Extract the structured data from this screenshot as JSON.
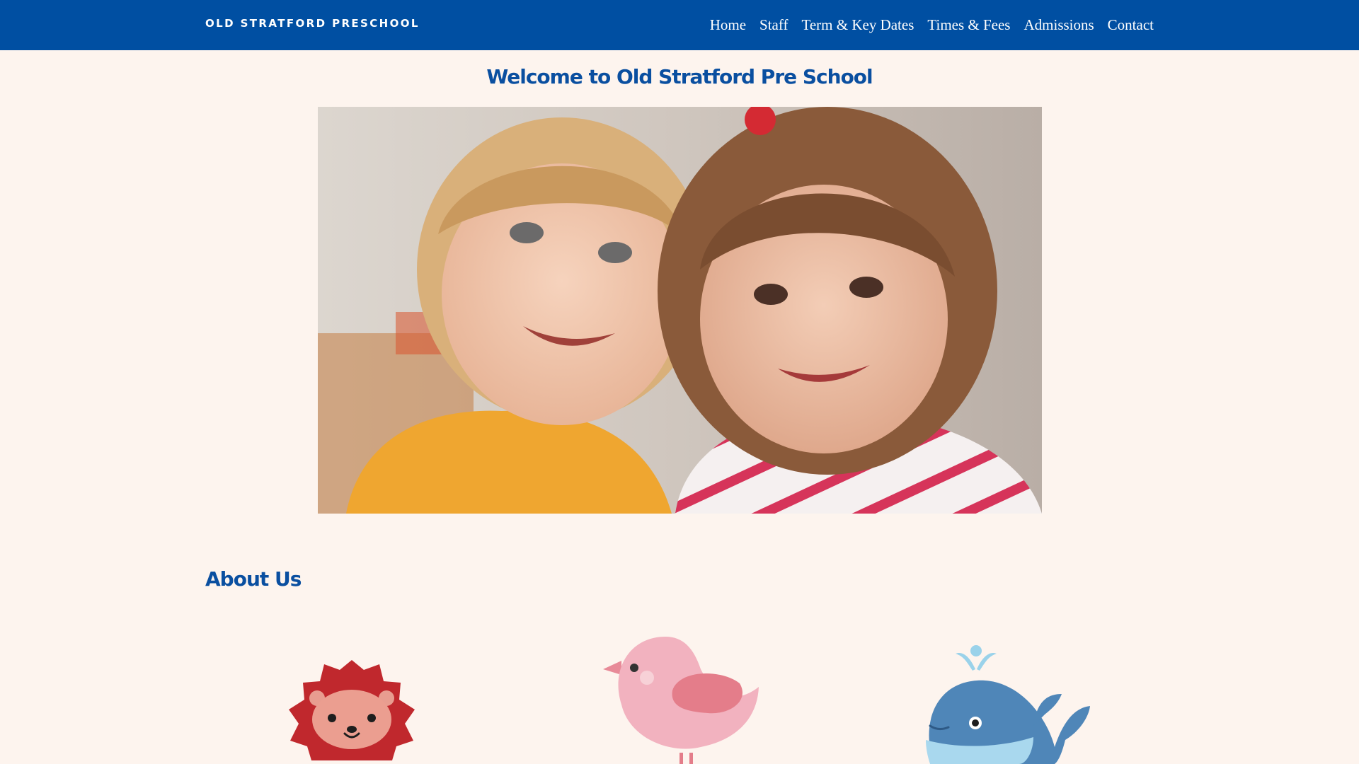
{
  "header": {
    "brand": "OLD STRATFORD PRESCHOOL",
    "nav": [
      "Home",
      "Staff",
      "Term & Key Dates",
      "Times & Fees",
      "Admissions",
      "Contact"
    ]
  },
  "main": {
    "welcome_title": "Welcome to Old Stratford Pre School",
    "hero_image": "two smiling children photo",
    "about_title": "About Us",
    "mascots": [
      "lion-icon",
      "bird-icon",
      "whale-icon"
    ]
  },
  "colors": {
    "header_bg": "#004fa2",
    "page_bg": "#fdf4ee",
    "heading": "#0a4fa0"
  }
}
